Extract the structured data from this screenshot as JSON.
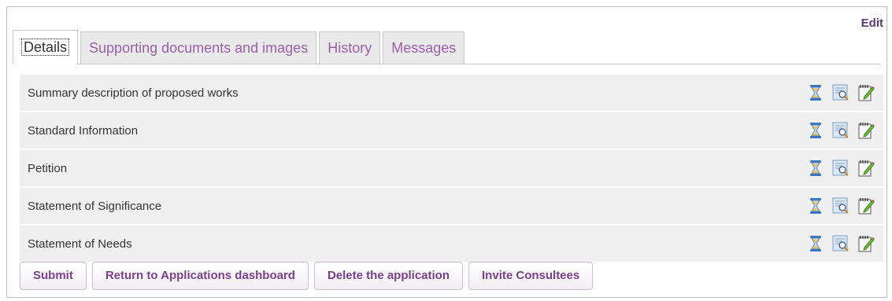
{
  "header": {
    "edit_label": "Edit"
  },
  "tabs": [
    {
      "label": "Details",
      "active": true
    },
    {
      "label": "Supporting documents and images",
      "active": false
    },
    {
      "label": "History",
      "active": false
    },
    {
      "label": "Messages",
      "active": false
    }
  ],
  "sections": [
    {
      "label": "Summary description of proposed works",
      "icons": [
        "hourglass-icon",
        "preview-icon",
        "edit-note-icon"
      ]
    },
    {
      "label": "Standard Information",
      "icons": [
        "hourglass-icon",
        "preview-icon",
        "edit-note-icon"
      ]
    },
    {
      "label": "Petition",
      "icons": [
        "hourglass-icon",
        "preview-icon",
        "edit-note-icon"
      ]
    },
    {
      "label": "Statement of Significance",
      "icons": [
        "hourglass-icon",
        "preview-icon",
        "edit-note-icon"
      ]
    },
    {
      "label": "Statement of Needs",
      "icons": [
        "hourglass-icon",
        "preview-icon",
        "edit-note-icon"
      ]
    }
  ],
  "actions": {
    "submit_label": "Submit",
    "return_label": "Return to Applications dashboard",
    "delete_label": "Delete the application",
    "invite_label": "Invite Consultees"
  },
  "colors": {
    "accent": "#7a3f8a",
    "tab_inactive_text": "#9a5fa8",
    "row_background": "#efefef"
  }
}
